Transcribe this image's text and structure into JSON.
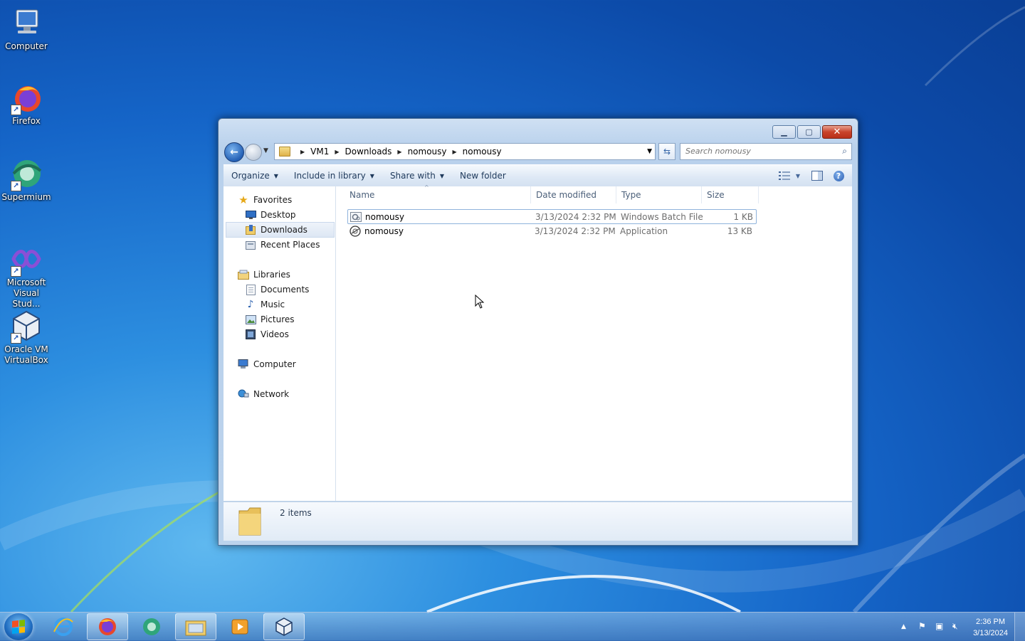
{
  "desktop": {
    "icons": [
      {
        "label": "Computer",
        "icon": "computer-icon"
      },
      {
        "label": "Firefox",
        "icon": "firefox-icon"
      },
      {
        "label": "Supermium",
        "icon": "supermium-icon"
      },
      {
        "label": "Microsoft Visual Stud...",
        "icon": "visual-studio-icon"
      },
      {
        "label": "Oracle VM VirtualBox",
        "icon": "virtualbox-icon"
      }
    ]
  },
  "explorer": {
    "breadcrumbs": [
      "VM1",
      "Downloads",
      "nomousy",
      "nomousy"
    ],
    "search_placeholder": "Search nomousy",
    "toolbar": {
      "organize": "Organize",
      "include_in_library": "Include in library",
      "share_with": "Share with",
      "new_folder": "New folder"
    },
    "nav": {
      "favorites": "Favorites",
      "desktop": "Desktop",
      "downloads": "Downloads",
      "recent_places": "Recent Places",
      "libraries": "Libraries",
      "documents": "Documents",
      "music": "Music",
      "pictures": "Pictures",
      "videos": "Videos",
      "computer": "Computer",
      "network": "Network",
      "selected": "Downloads"
    },
    "columns": [
      "Name",
      "Date modified",
      "Type",
      "Size"
    ],
    "files": [
      {
        "name": "nomousy",
        "date": "3/13/2024 2:32 PM",
        "type": "Windows Batch File",
        "size": "1 KB",
        "icon": "batch-file-icon"
      },
      {
        "name": "nomousy",
        "date": "3/13/2024 2:32 PM",
        "type": "Application",
        "size": "13 KB",
        "icon": "application-icon"
      }
    ],
    "status": "2 items"
  },
  "taskbar": {
    "pinned": [
      "internet-explorer-icon",
      "firefox-icon",
      "supermium-icon",
      "windows-explorer-icon",
      "media-player-icon",
      "virtualbox-icon"
    ],
    "clock_time": "2:36 PM",
    "clock_date": "3/13/2024"
  },
  "colors": {
    "desktop_blue": "#1565c8",
    "window_frame": "#bcd3ec",
    "close_red": "#c9432a"
  }
}
